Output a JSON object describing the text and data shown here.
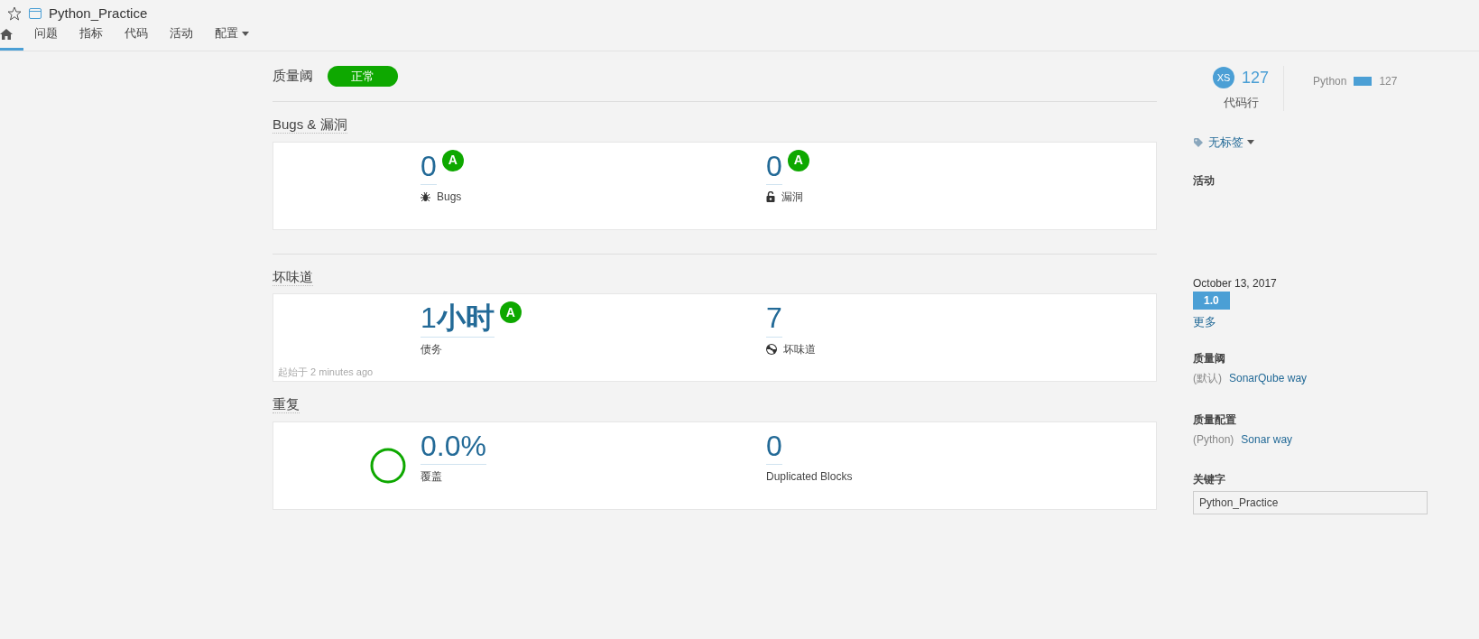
{
  "header": {
    "title": "Python_Practice"
  },
  "tabs": [
    {
      "kind": "home",
      "selected": true
    },
    {
      "kind": "text",
      "label": "问题",
      "selected": false
    },
    {
      "kind": "text",
      "label": "指标",
      "selected": false
    },
    {
      "kind": "text",
      "label": "代码",
      "selected": false
    },
    {
      "kind": "text",
      "label": "活动",
      "selected": false
    },
    {
      "kind": "dropdown",
      "label": "配置",
      "selected": false
    }
  ],
  "quality_gate": {
    "label": "质量阈",
    "status": "正常",
    "color": "#0ea800"
  },
  "sections": [
    {
      "kind": "issues",
      "title": "Bugs & 漏洞",
      "metrics": [
        {
          "value": "0",
          "label": "Bugs",
          "rating": "A"
        },
        {
          "value": "0",
          "label": "漏洞",
          "rating": "A"
        }
      ]
    },
    {
      "kind": "maintainability",
      "title": "坏味道",
      "note": "起始于 2 minutes ago",
      "metrics": [
        {
          "value": "1**小时**",
          "label": "债务",
          "rating": "A"
        },
        {
          "value": "7",
          "label": "坏味道"
        }
      ]
    },
    {
      "kind": "duplications",
      "title": "重复",
      "metrics": [
        {
          "value": "0.0%",
          "label": "覆盖"
        },
        {
          "value": "0",
          "label": "Duplicated Blocks"
        }
      ]
    }
  ],
  "sidebar": {
    "size": {
      "avatar": "XS",
      "value": "127",
      "label": "代码行"
    },
    "languages": [
      {
        "name": "Python",
        "value": "127"
      }
    ],
    "tags": "无标签",
    "activity": {
      "title": "活动",
      "date": "October 13, 2017",
      "version": "1.0",
      "more": "更多"
    },
    "quality_gate": {
      "title": "质量阈",
      "prefix": "(默认)",
      "link": "SonarQube way"
    },
    "quality_profile": {
      "title": "质量配置",
      "prefix": "(Python)",
      "link": "Sonar way"
    },
    "key": {
      "title": "关键字",
      "value": "Python_Practice"
    }
  }
}
